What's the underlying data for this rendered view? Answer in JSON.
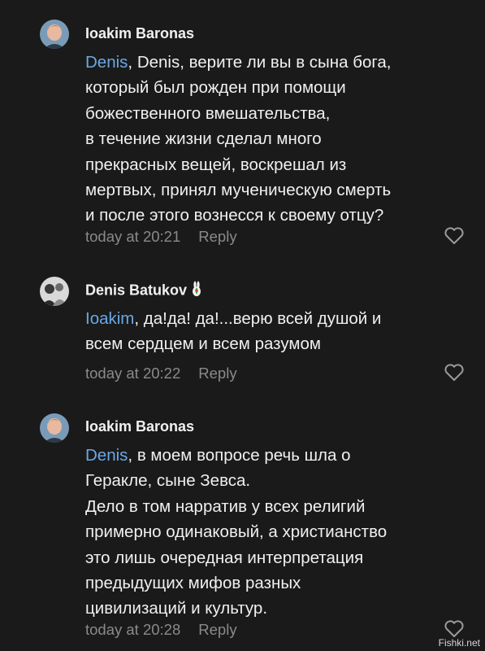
{
  "comments": [
    {
      "author": "Ioakim Baronas",
      "mention": "Denis",
      "text": ", Denis, верите ли вы в сына бога,\nкоторый был рожден при помощи\nбожественного вмешательства,\nв течение жизни сделал много\nпрекрасных вещей, воскрешал из\nмертвых, принял мученическую смерть\nи после этого вознесся к своему отцу?",
      "time": "today at 20:21",
      "reply": "Reply"
    },
    {
      "author": "Denis Batukov",
      "mention": "Ioakim",
      "text": ", да!да! да!...верю всей душой и\nвсем сердцем и всем разумом",
      "time": "today at 20:22",
      "reply": "Reply"
    },
    {
      "author": "Ioakim Baronas",
      "mention": "Denis",
      "text": ", в моем вопросе речь шла о\nГеракле, сыне Зевса.\nДело в том нарратив у всех религий\nпримерно одинаковый, а христианство\nэто лишь очередная интерпретация\nпредыдущих мифов разных\nцивилизаций и культур.",
      "time": "today at 20:28",
      "reply": "Reply"
    }
  ],
  "watermark": "Fishki.net",
  "colors": {
    "background": "#1a1a1a",
    "mention": "#6aa8e6",
    "meta": "#8a8a8a"
  },
  "icons": {
    "like": "heart-outline-icon",
    "author_badge": "bunny-emoji-icon"
  }
}
